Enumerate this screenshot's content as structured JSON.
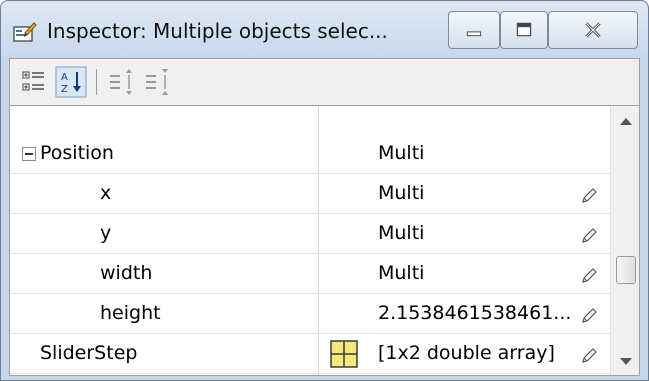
{
  "window": {
    "title": "Inspector:  Multiple objects selec...",
    "icons": {
      "app": "inspector-pencil-icon",
      "minimize": "minimize-icon",
      "maximize": "maximize-icon",
      "close": "close-icon"
    }
  },
  "toolbar": {
    "buttons": [
      {
        "name": "categorized-view-icon"
      },
      {
        "name": "alphabetical-sort-icon",
        "active": true
      },
      {
        "name": "expand-all-icon"
      },
      {
        "name": "collapse-all-icon"
      }
    ]
  },
  "properties": [
    {
      "name": "Position",
      "value": "Multi",
      "expandable": true,
      "editable": false
    },
    {
      "name": "x",
      "value": "Multi",
      "editable": true
    },
    {
      "name": "y",
      "value": "Multi",
      "editable": true
    },
    {
      "name": "width",
      "value": "Multi",
      "editable": true
    },
    {
      "name": "height",
      "value": "2.1538461538461...",
      "editable": true
    },
    {
      "name": "SliderStep",
      "value": "[1x2  double array]",
      "editable": true,
      "icon": "table-icon"
    }
  ]
}
